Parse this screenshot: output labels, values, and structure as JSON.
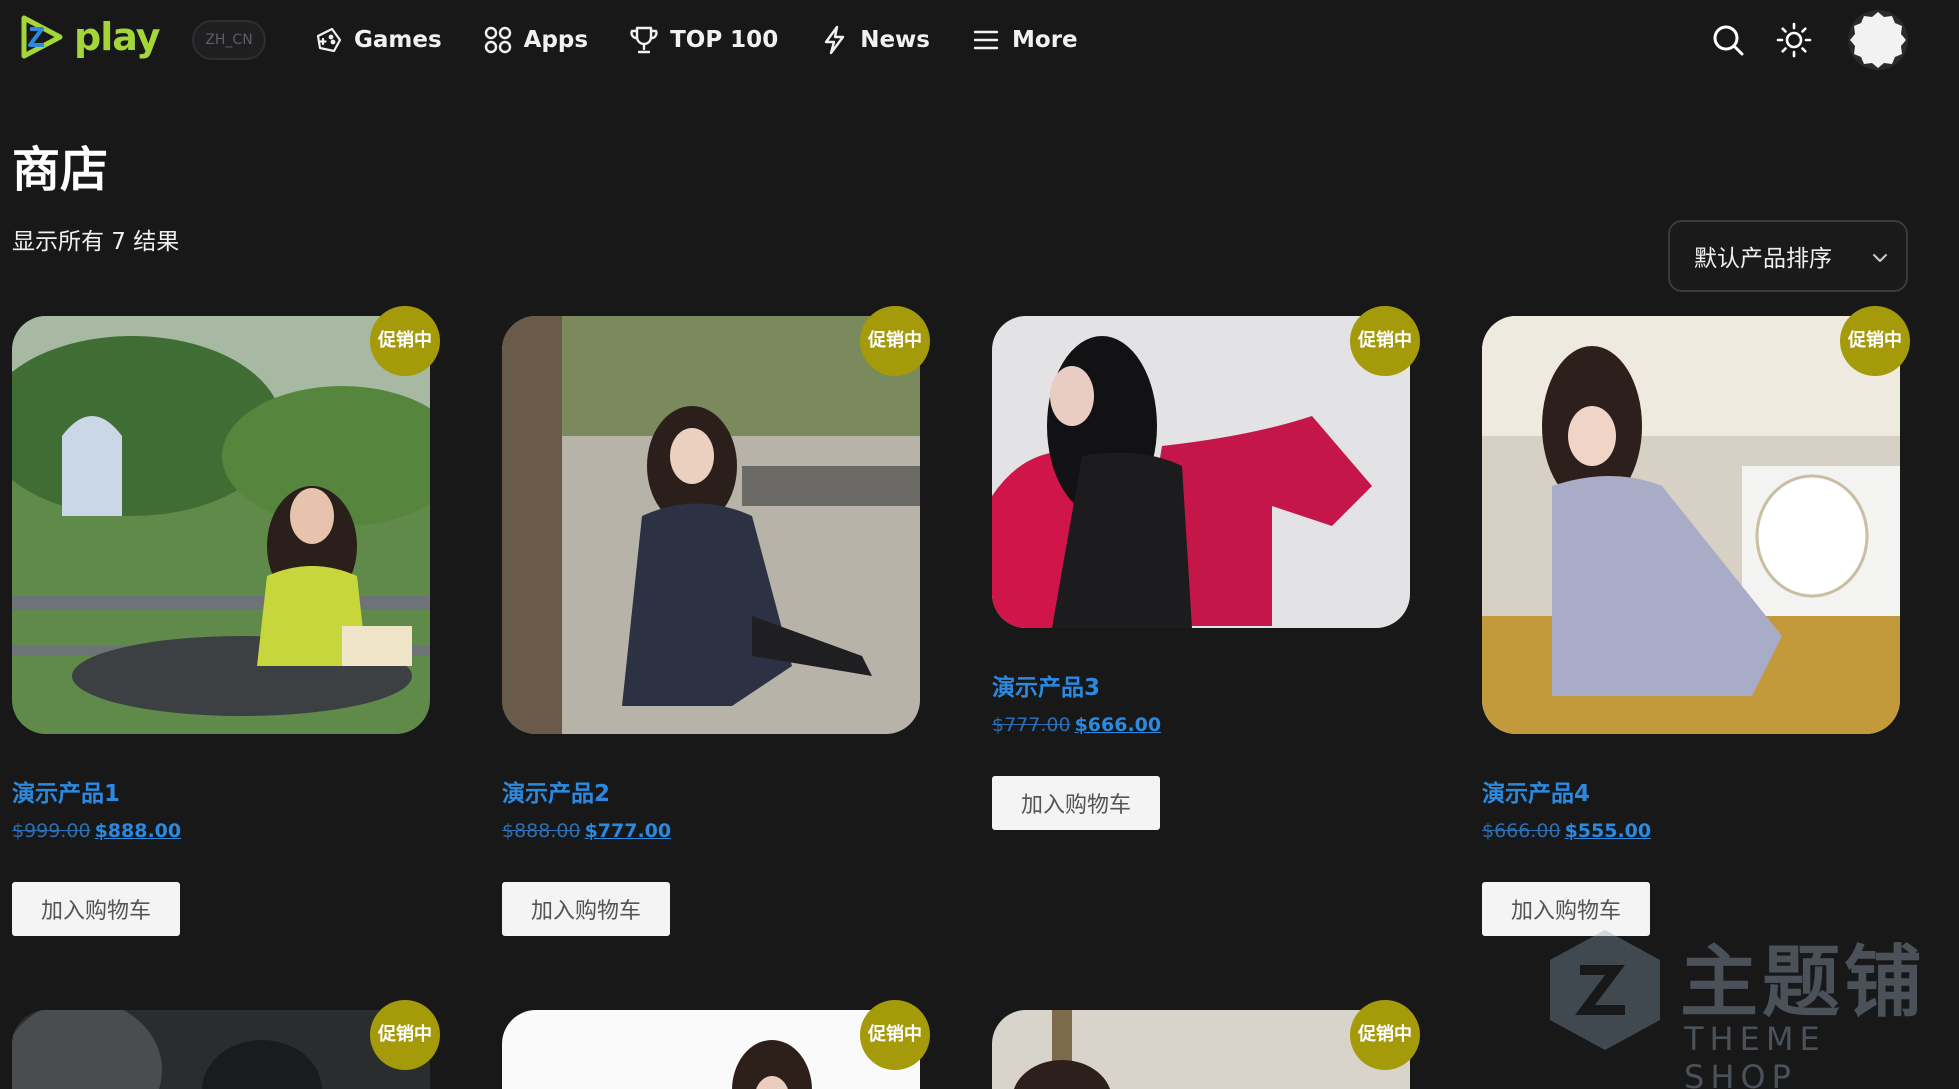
{
  "header": {
    "logo_text": "play",
    "lang": "ZH_CN",
    "nav": [
      {
        "label": "Games",
        "icon": "gamepad-icon"
      },
      {
        "label": "Apps",
        "icon": "apps-grid-icon"
      },
      {
        "label": "TOP 100",
        "icon": "trophy-icon"
      },
      {
        "label": "News",
        "icon": "lightning-icon"
      },
      {
        "label": "More",
        "icon": "menu-icon"
      }
    ]
  },
  "page": {
    "title": "商店",
    "result_count": "显示所有 7 结果",
    "sort_label": "默认产品排序"
  },
  "sale_badge": "促销中",
  "add_to_cart": "加入购物车",
  "products": [
    {
      "title": "演示产品1",
      "old_price": "$999.00",
      "new_price": "$888.00"
    },
    {
      "title": "演示产品2",
      "old_price": "$888.00",
      "new_price": "$777.00"
    },
    {
      "title": "演示产品3",
      "old_price": "$777.00",
      "new_price": "$666.00"
    },
    {
      "title": "演示产品4",
      "old_price": "$666.00",
      "new_price": "$555.00"
    }
  ],
  "watermark": {
    "title": "主题铺",
    "subtitle": "THEME SHOP"
  },
  "colors": {
    "accent": "#a4d63a",
    "link": "#2b89e0",
    "badge": "#a49a0a",
    "bg": "#181819"
  }
}
